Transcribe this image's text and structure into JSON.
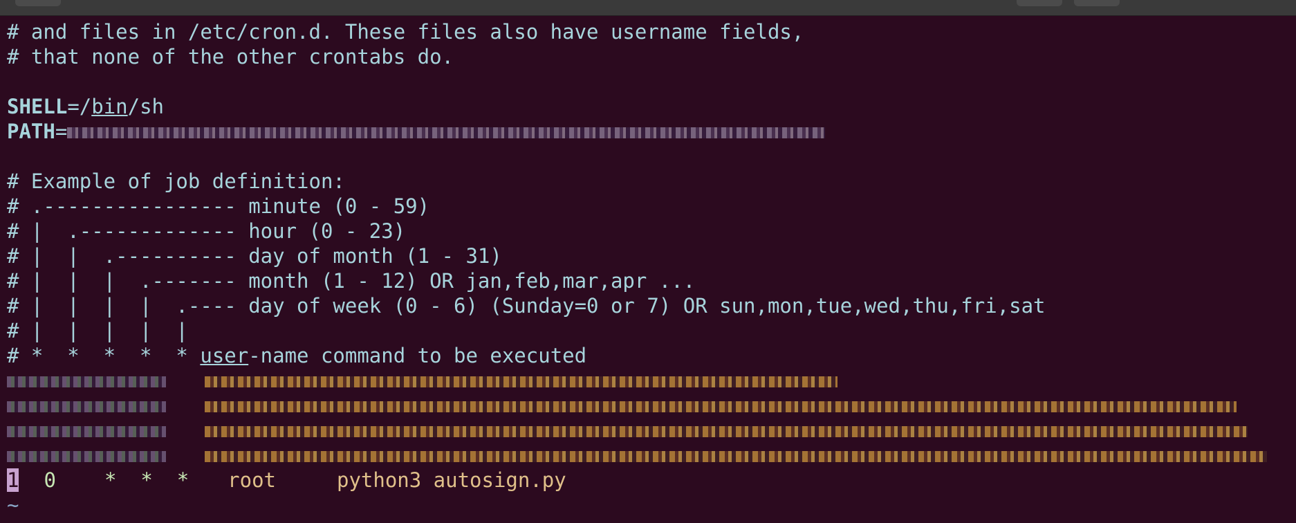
{
  "terminal": {
    "lines": {
      "l1": "# and files in /etc/cron.d. These files also have username fields,",
      "l2": "# that none of the other crontabs do.",
      "shell_key": "SHELL",
      "shell_pre": "=/",
      "shell_bin": "bin",
      "shell_post": "/sh",
      "path_key": "PATH",
      "path_eq": "=",
      "ex": "# Example of job definition:",
      "c1": "# .---------------- minute (0 - 59)",
      "c2": "# |  .------------- hour (0 - 23)",
      "c3": "# |  |  .---------- day of month (1 - 31)",
      "c4": "# |  |  |  .------- month (1 - 12) OR jan,feb,mar,apr ...",
      "c5": "# |  |  |  |  .---- day of week (0 - 6) (Sunday=0 or 7) OR sun,mon,tue,wed,thu,fri,sat",
      "c6": "# |  |  |  |  |",
      "c7_pre": "# *  *  *  *  * ",
      "c7_user": "user",
      "c7_post": "-name command to be executed"
    },
    "job": {
      "cursor_char": "1",
      "minute_rest": "",
      "hour": "0",
      "stars": "*  *  *",
      "user": "root",
      "command": "python3 autosign.py"
    },
    "tilde": "~"
  },
  "colors": {
    "background": "#2c0a1f",
    "comment_text": "#a7d4dc",
    "cron_fields": "#c6e6b3",
    "user_command": "#e0c08a",
    "cursor": "#c8a2cf"
  }
}
